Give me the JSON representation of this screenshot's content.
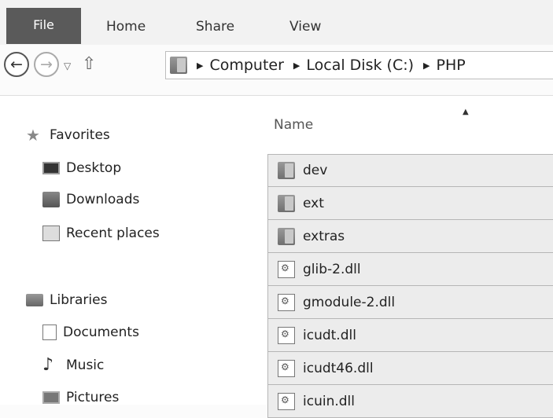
{
  "ribbon": {
    "tabs": [
      "File",
      "Home",
      "Share",
      "View"
    ]
  },
  "nav": {
    "back_icon": "back-arrow-icon",
    "forward_icon": "forward-arrow-icon",
    "recent_icon": "chevron-down-icon",
    "up_icon": "up-arrow-icon"
  },
  "address": {
    "segments": [
      "Computer",
      "Local Disk (C:)",
      "PHP"
    ]
  },
  "navpane": {
    "favorites_label": "Favorites",
    "favorites": [
      "Desktop",
      "Downloads",
      "Recent places"
    ],
    "libraries_label": "Libraries",
    "libraries": [
      "Documents",
      "Music",
      "Pictures"
    ]
  },
  "content": {
    "column_name": "Name",
    "files": [
      {
        "name": "dev",
        "type": "folder"
      },
      {
        "name": "ext",
        "type": "folder"
      },
      {
        "name": "extras",
        "type": "folder"
      },
      {
        "name": "glib-2.dll",
        "type": "dll"
      },
      {
        "name": "gmodule-2.dll",
        "type": "dll"
      },
      {
        "name": "icudt.dll",
        "type": "dll"
      },
      {
        "name": "icudt46.dll",
        "type": "dll"
      },
      {
        "name": "icuin.dll",
        "type": "dll"
      }
    ]
  }
}
